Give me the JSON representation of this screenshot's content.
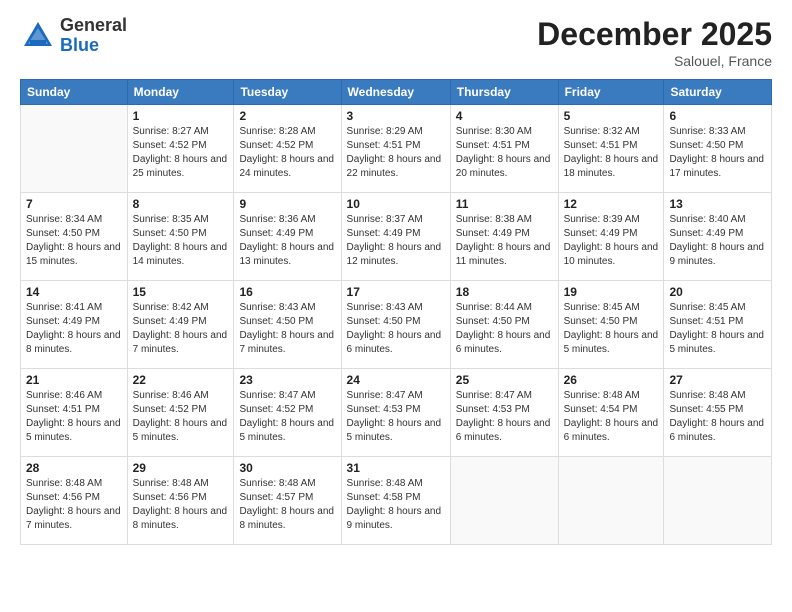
{
  "logo": {
    "general": "General",
    "blue": "Blue"
  },
  "title": "December 2025",
  "location": "Salouel, France",
  "days_of_week": [
    "Sunday",
    "Monday",
    "Tuesday",
    "Wednesday",
    "Thursday",
    "Friday",
    "Saturday"
  ],
  "weeks": [
    [
      {
        "day": "",
        "info": ""
      },
      {
        "day": "1",
        "info": "Sunrise: 8:27 AM\nSunset: 4:52 PM\nDaylight: 8 hours\nand 25 minutes."
      },
      {
        "day": "2",
        "info": "Sunrise: 8:28 AM\nSunset: 4:52 PM\nDaylight: 8 hours\nand 24 minutes."
      },
      {
        "day": "3",
        "info": "Sunrise: 8:29 AM\nSunset: 4:51 PM\nDaylight: 8 hours\nand 22 minutes."
      },
      {
        "day": "4",
        "info": "Sunrise: 8:30 AM\nSunset: 4:51 PM\nDaylight: 8 hours\nand 20 minutes."
      },
      {
        "day": "5",
        "info": "Sunrise: 8:32 AM\nSunset: 4:51 PM\nDaylight: 8 hours\nand 18 minutes."
      },
      {
        "day": "6",
        "info": "Sunrise: 8:33 AM\nSunset: 4:50 PM\nDaylight: 8 hours\nand 17 minutes."
      }
    ],
    [
      {
        "day": "7",
        "info": "Sunrise: 8:34 AM\nSunset: 4:50 PM\nDaylight: 8 hours\nand 15 minutes."
      },
      {
        "day": "8",
        "info": "Sunrise: 8:35 AM\nSunset: 4:50 PM\nDaylight: 8 hours\nand 14 minutes."
      },
      {
        "day": "9",
        "info": "Sunrise: 8:36 AM\nSunset: 4:49 PM\nDaylight: 8 hours\nand 13 minutes."
      },
      {
        "day": "10",
        "info": "Sunrise: 8:37 AM\nSunset: 4:49 PM\nDaylight: 8 hours\nand 12 minutes."
      },
      {
        "day": "11",
        "info": "Sunrise: 8:38 AM\nSunset: 4:49 PM\nDaylight: 8 hours\nand 11 minutes."
      },
      {
        "day": "12",
        "info": "Sunrise: 8:39 AM\nSunset: 4:49 PM\nDaylight: 8 hours\nand 10 minutes."
      },
      {
        "day": "13",
        "info": "Sunrise: 8:40 AM\nSunset: 4:49 PM\nDaylight: 8 hours\nand 9 minutes."
      }
    ],
    [
      {
        "day": "14",
        "info": "Sunrise: 8:41 AM\nSunset: 4:49 PM\nDaylight: 8 hours\nand 8 minutes."
      },
      {
        "day": "15",
        "info": "Sunrise: 8:42 AM\nSunset: 4:49 PM\nDaylight: 8 hours\nand 7 minutes."
      },
      {
        "day": "16",
        "info": "Sunrise: 8:43 AM\nSunset: 4:50 PM\nDaylight: 8 hours\nand 7 minutes."
      },
      {
        "day": "17",
        "info": "Sunrise: 8:43 AM\nSunset: 4:50 PM\nDaylight: 8 hours\nand 6 minutes."
      },
      {
        "day": "18",
        "info": "Sunrise: 8:44 AM\nSunset: 4:50 PM\nDaylight: 8 hours\nand 6 minutes."
      },
      {
        "day": "19",
        "info": "Sunrise: 8:45 AM\nSunset: 4:50 PM\nDaylight: 8 hours\nand 5 minutes."
      },
      {
        "day": "20",
        "info": "Sunrise: 8:45 AM\nSunset: 4:51 PM\nDaylight: 8 hours\nand 5 minutes."
      }
    ],
    [
      {
        "day": "21",
        "info": "Sunrise: 8:46 AM\nSunset: 4:51 PM\nDaylight: 8 hours\nand 5 minutes."
      },
      {
        "day": "22",
        "info": "Sunrise: 8:46 AM\nSunset: 4:52 PM\nDaylight: 8 hours\nand 5 minutes."
      },
      {
        "day": "23",
        "info": "Sunrise: 8:47 AM\nSunset: 4:52 PM\nDaylight: 8 hours\nand 5 minutes."
      },
      {
        "day": "24",
        "info": "Sunrise: 8:47 AM\nSunset: 4:53 PM\nDaylight: 8 hours\nand 5 minutes."
      },
      {
        "day": "25",
        "info": "Sunrise: 8:47 AM\nSunset: 4:53 PM\nDaylight: 8 hours\nand 6 minutes."
      },
      {
        "day": "26",
        "info": "Sunrise: 8:48 AM\nSunset: 4:54 PM\nDaylight: 8 hours\nand 6 minutes."
      },
      {
        "day": "27",
        "info": "Sunrise: 8:48 AM\nSunset: 4:55 PM\nDaylight: 8 hours\nand 6 minutes."
      }
    ],
    [
      {
        "day": "28",
        "info": "Sunrise: 8:48 AM\nSunset: 4:56 PM\nDaylight: 8 hours\nand 7 minutes."
      },
      {
        "day": "29",
        "info": "Sunrise: 8:48 AM\nSunset: 4:56 PM\nDaylight: 8 hours\nand 8 minutes."
      },
      {
        "day": "30",
        "info": "Sunrise: 8:48 AM\nSunset: 4:57 PM\nDaylight: 8 hours\nand 8 minutes."
      },
      {
        "day": "31",
        "info": "Sunrise: 8:48 AM\nSunset: 4:58 PM\nDaylight: 8 hours\nand 9 minutes."
      },
      {
        "day": "",
        "info": ""
      },
      {
        "day": "",
        "info": ""
      },
      {
        "day": "",
        "info": ""
      }
    ]
  ]
}
